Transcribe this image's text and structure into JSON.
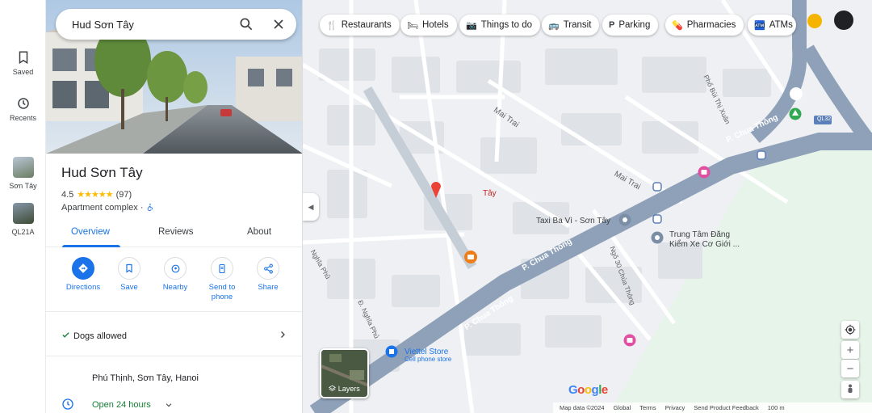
{
  "rail": {
    "saved_label": "Saved",
    "recents_label": "Recents",
    "recent1_label": "Sơn Tây",
    "recent2_label": "QL21A"
  },
  "search": {
    "value": "Hud Sơn Tây"
  },
  "place": {
    "title": "Hud Sơn Tây",
    "rating": "4.5",
    "stars": "★★★★★",
    "review_count": "(97)",
    "category": "Apartment complex ·"
  },
  "tabs": [
    "Overview",
    "Reviews",
    "About"
  ],
  "actions": {
    "directions": "Directions",
    "save": "Save",
    "nearby": "Nearby",
    "send_to_phone": "Send to phone",
    "share": "Share"
  },
  "info": {
    "dogs": "Dogs allowed",
    "address": "Phú Thịnh, Sơn Tây, Hanoi",
    "hours": "Open 24 hours"
  },
  "chips": [
    {
      "icon": "🍴",
      "label": "Restaurants"
    },
    {
      "icon": "🛏",
      "label": "Hotels"
    },
    {
      "icon": "📷",
      "label": "Things to do"
    },
    {
      "icon": "🚌",
      "label": "Transit"
    },
    {
      "icon": "P",
      "label": "Parking"
    },
    {
      "icon": "💊",
      "label": "Pharmacies"
    },
    {
      "icon": "🏧",
      "label": "ATMs"
    }
  ],
  "map_labels": {
    "mai_trai_1": "Mai Trai",
    "mai_trai_2": "Mai Trai",
    "pho_bui": "Phố Bùi Thị Xuân",
    "chua_thong_1": "P. Chua Thông",
    "chua_thong_2": "P. Chua Thông",
    "chua_thong_3": "P. Chua Thông",
    "tay": "Tây",
    "taxi": "Taxi Ba Vì - Sơn Tây",
    "trung_tam": "Trung Tâm Đăng",
    "kiem_xe": "Kiểm Xe Cơ Giới ...",
    "ngo30": "Ngõ 30 Chùa Thông",
    "nghia_phu": "Nghĩa Phủ",
    "d_nghia_phu": "Đ. Nghĩa Phủ",
    "viettel": "Viettel Store",
    "viettel_sub": "Cell phone store",
    "ql32": "QL32"
  },
  "map_controls": {
    "layers_label": "Layers",
    "zoom_in": "+",
    "zoom_out": "−"
  },
  "footer": {
    "map_data": "Map data ©2024",
    "global": "Global",
    "terms": "Terms",
    "privacy": "Privacy",
    "feedback": "Send Product Feedback",
    "scale": "100 m"
  },
  "google_logo": "Google",
  "colors": {
    "accent": "#1a73e8",
    "road_major": "#8fa1b8",
    "pin": "#ea4335",
    "park": "#e6f4e9"
  }
}
